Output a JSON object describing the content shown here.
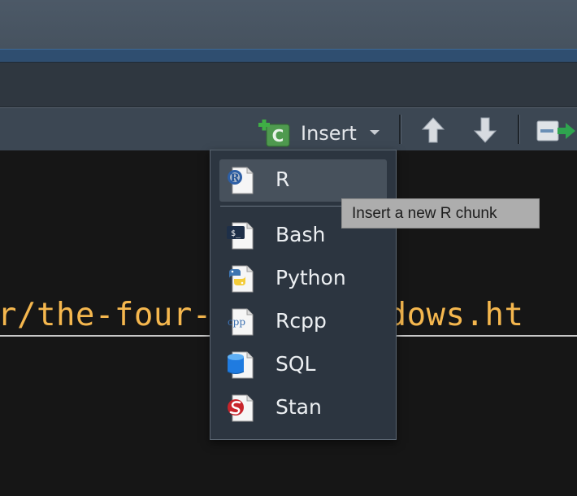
{
  "toolbar": {
    "insert_label": "Insert",
    "insert_icon": "add-chunk-icon",
    "insert_icon_letter": "C",
    "icons": [
      "arrow-up-icon",
      "arrow-down-icon",
      "run-chunk-icon"
    ]
  },
  "editor": {
    "code_text": "r/the-four-      windows.ht"
  },
  "dropdown": {
    "items": [
      {
        "label": "R",
        "icon": "r-file-icon",
        "icon_text": "R",
        "selected": true
      },
      {
        "label": "Bash",
        "icon": "bash-file-icon",
        "icon_text": "$_",
        "selected": false
      },
      {
        "label": "Python",
        "icon": "python-file-icon",
        "icon_text": "",
        "selected": false
      },
      {
        "label": "Rcpp",
        "icon": "rcpp-file-icon",
        "icon_text": "cpp",
        "selected": false
      },
      {
        "label": "SQL",
        "icon": "sql-database-icon",
        "icon_text": "",
        "selected": false
      },
      {
        "label": "Stan",
        "icon": "stan-file-icon",
        "icon_text": "",
        "selected": false
      }
    ]
  },
  "tooltip": {
    "text": "Insert a new R chunk"
  },
  "colors": {
    "code": "#f5b74e",
    "toolbar": "#3c4753",
    "menu_bg": "#2c3540",
    "menu_selected": "#47515c",
    "tooltip_bg": "#adadad"
  }
}
